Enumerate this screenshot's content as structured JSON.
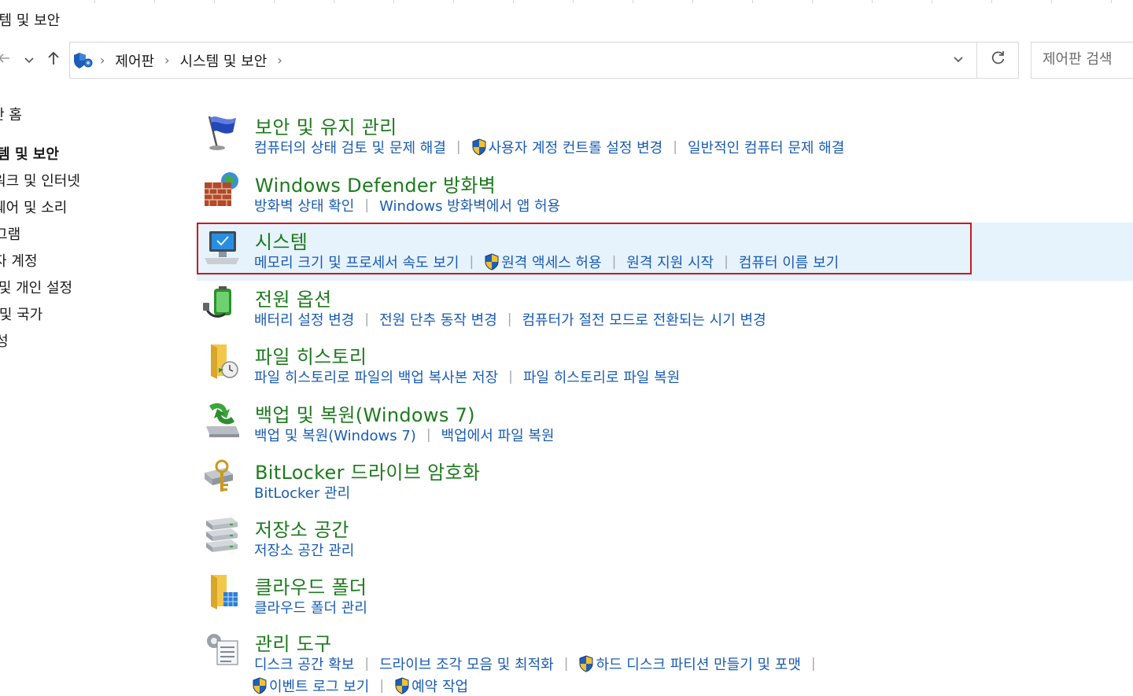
{
  "window": {
    "title": "스템 및 보안"
  },
  "nav": {
    "back_icon": "back-arrow-icon",
    "recent_icon": "chevron-down-icon",
    "up_icon": "up-arrow-icon"
  },
  "address": {
    "crumbs": [
      "제어판",
      "시스템 및 보안"
    ],
    "dropdown_icon": "chevron-down-icon",
    "refresh_icon": "refresh-icon"
  },
  "search": {
    "placeholder": "제어판 검색"
  },
  "sidebar": {
    "items": [
      {
        "label": "제어판 홈",
        "current": false
      },
      {
        "label": "시스템 및 보안",
        "current": true
      },
      {
        "label": "네트워크 및 인터넷",
        "current": false
      },
      {
        "label": "하드웨어 및 소리",
        "current": false
      },
      {
        "label": "프로그램",
        "current": false
      },
      {
        "label": "사용자 계정",
        "current": false
      },
      {
        "label": "모양 및 개인 설정",
        "current": false
      },
      {
        "label": "시계 및 국가",
        "current": false
      },
      {
        "label": "접근성",
        "current": false
      }
    ]
  },
  "categories": [
    {
      "title": "보안 및 유지 관리",
      "icon": "flag-icon",
      "links": [
        {
          "text": "컴퓨터의 상태 검토 및 문제 해결",
          "shield": false
        },
        {
          "text": "사용자 계정 컨트롤 설정 변경",
          "shield": true
        },
        {
          "text": "일반적인 컴퓨터 문제 해결",
          "shield": false
        }
      ]
    },
    {
      "title": "Windows Defender 방화벽",
      "icon": "firewall-icon",
      "links": [
        {
          "text": "방화벽 상태 확인",
          "shield": false
        },
        {
          "text": "Windows 방화벽에서 앱 허용",
          "shield": false
        }
      ]
    },
    {
      "title": "시스템",
      "icon": "computer-icon",
      "highlighted": true,
      "links": [
        {
          "text": "메모리 크기 및 프로세서 속도 보기",
          "shield": false
        },
        {
          "text": "원격 액세스 허용",
          "shield": true
        },
        {
          "text": "원격 지원 시작",
          "shield": false
        },
        {
          "text": "컴퓨터 이름 보기",
          "shield": false
        }
      ]
    },
    {
      "title": "전원 옵션",
      "icon": "battery-icon",
      "links": [
        {
          "text": "배터리 설정 변경",
          "shield": false
        },
        {
          "text": "전원 단추 동작 변경",
          "shield": false
        },
        {
          "text": "컴퓨터가 절전 모드로 전환되는 시기 변경",
          "shield": false
        }
      ]
    },
    {
      "title": "파일 히스토리",
      "icon": "file-history-icon",
      "links": [
        {
          "text": "파일 히스토리로 파일의 백업 복사본 저장",
          "shield": false
        },
        {
          "text": "파일 히스토리로 파일 복원",
          "shield": false
        }
      ]
    },
    {
      "title": "백업 및 복원(Windows 7)",
      "icon": "backup-icon",
      "links": [
        {
          "text": "백업 및 복원(Windows 7)",
          "shield": false
        },
        {
          "text": "백업에서 파일 복원",
          "shield": false
        }
      ]
    },
    {
      "title": "BitLocker 드라이브 암호화",
      "icon": "bitlocker-key-icon",
      "links": [
        {
          "text": "BitLocker 관리",
          "shield": false
        }
      ]
    },
    {
      "title": "저장소 공간",
      "icon": "storage-spaces-icon",
      "links": [
        {
          "text": "저장소 공간 관리",
          "shield": false
        }
      ]
    },
    {
      "title": "클라우드 폴더",
      "icon": "cloud-folder-icon",
      "links": [
        {
          "text": "클라우드 폴더 관리",
          "shield": false
        }
      ]
    },
    {
      "title": "관리 도구",
      "icon": "admin-tools-icon",
      "links": [
        {
          "text": "디스크 공간 확보",
          "shield": false
        },
        {
          "text": "드라이브 조각 모음 및 최적화",
          "shield": false
        },
        {
          "text": "하드 디스크 파티션 만들기 및 포맷",
          "shield": true
        }
      ],
      "links2": [
        {
          "text": "이벤트 로그 보기",
          "shield": true
        },
        {
          "text": "예약 작업",
          "shield": true
        }
      ]
    }
  ],
  "colors": {
    "title_green": "#1e7a1e",
    "link_blue": "#1a5cb4",
    "highlight_bg": "#e6f2fc",
    "highlight_border": "#c81a1f"
  }
}
